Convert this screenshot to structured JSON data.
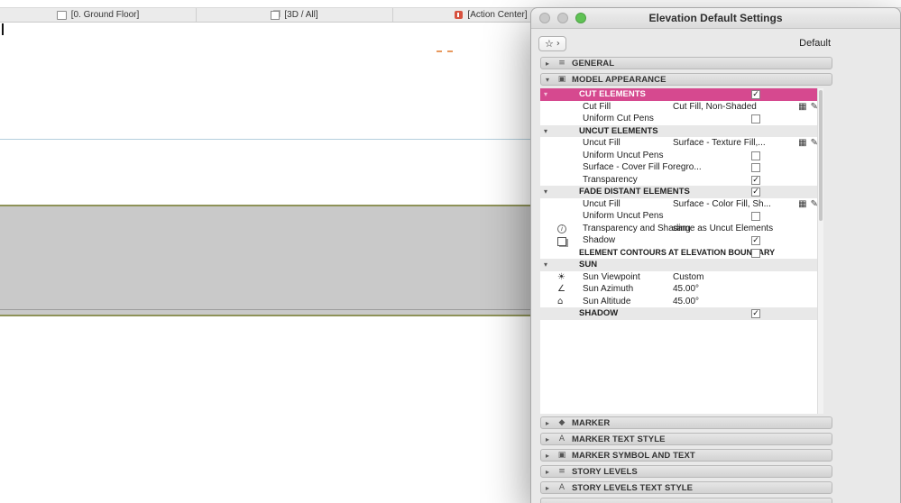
{
  "colors": {
    "highlight": "#d6498f",
    "traffic_green": "#5fc254",
    "action_center_red": "#d7523f",
    "band_olive": "#8e9258",
    "guide_blue": "#b4cfdd",
    "dash_orange": "#e8995f"
  },
  "icons": {
    "tri_right": "▸",
    "tri_down": "▾",
    "star": "☆",
    "chevron": "›",
    "fill": "▦",
    "pens": "✎",
    "sun": "☀",
    "azimuth": "∠",
    "altitude": "⌂",
    "info": "i"
  },
  "tabs": {
    "items": [
      {
        "label": "[0. Ground Floor]"
      },
      {
        "label": "[3D / All]"
      },
      {
        "label": "[Action Center]"
      }
    ]
  },
  "dialog": {
    "title": "Elevation Default Settings",
    "preset": "Default",
    "sections_top": [
      {
        "label": "GENERAL",
        "icon": "≡"
      },
      {
        "label": "MODEL APPEARANCE",
        "icon": "▣"
      }
    ],
    "cut_header": {
      "label": "CUT ELEMENTS",
      "checked": true
    },
    "rows": [
      {
        "label": "Cut Fill",
        "value": "Cut Fill, Non-Shaded"
      },
      {
        "label": "Uniform Cut Pens",
        "checked": false
      },
      {
        "label": "UNCUT ELEMENTS"
      },
      {
        "label": "Uncut Fill",
        "value": "Surface - Texture Fill,..."
      },
      {
        "label": "Uniform Uncut Pens",
        "checked": false
      },
      {
        "label": "Surface - Cover Fill Foregro...",
        "checked": false
      },
      {
        "label": "Transparency",
        "checked": true
      },
      {
        "label": "FADE DISTANT ELEMENTS",
        "checked": true
      },
      {
        "label": "Uncut Fill",
        "value": "Surface - Color Fill, Sh..."
      },
      {
        "label": "Uniform Uncut Pens",
        "checked": false
      },
      {
        "label": "Transparency and Shading",
        "value": "same as Uncut Elements"
      },
      {
        "label": "Shadow",
        "checked": true
      },
      {
        "label": "ELEMENT CONTOURS AT ELEVATION BOUNDARY",
        "checked": false
      },
      {
        "label": "SUN"
      },
      {
        "label": "Sun Viewpoint",
        "value": "Custom"
      },
      {
        "label": "Sun Azimuth",
        "value": "45.00°"
      },
      {
        "label": "Sun Altitude",
        "value": "45.00°"
      },
      {
        "label": "SHADOW",
        "checked": true
      }
    ],
    "sections_bottom": [
      {
        "label": "MARKER",
        "icon": "◆"
      },
      {
        "label": "MARKER TEXT STYLE",
        "icon": "A"
      },
      {
        "label": "MARKER SYMBOL AND TEXT",
        "icon": "▣"
      },
      {
        "label": "STORY LEVELS",
        "icon": "≡"
      },
      {
        "label": "STORY LEVELS TEXT STYLE",
        "icon": "A"
      }
    ]
  }
}
